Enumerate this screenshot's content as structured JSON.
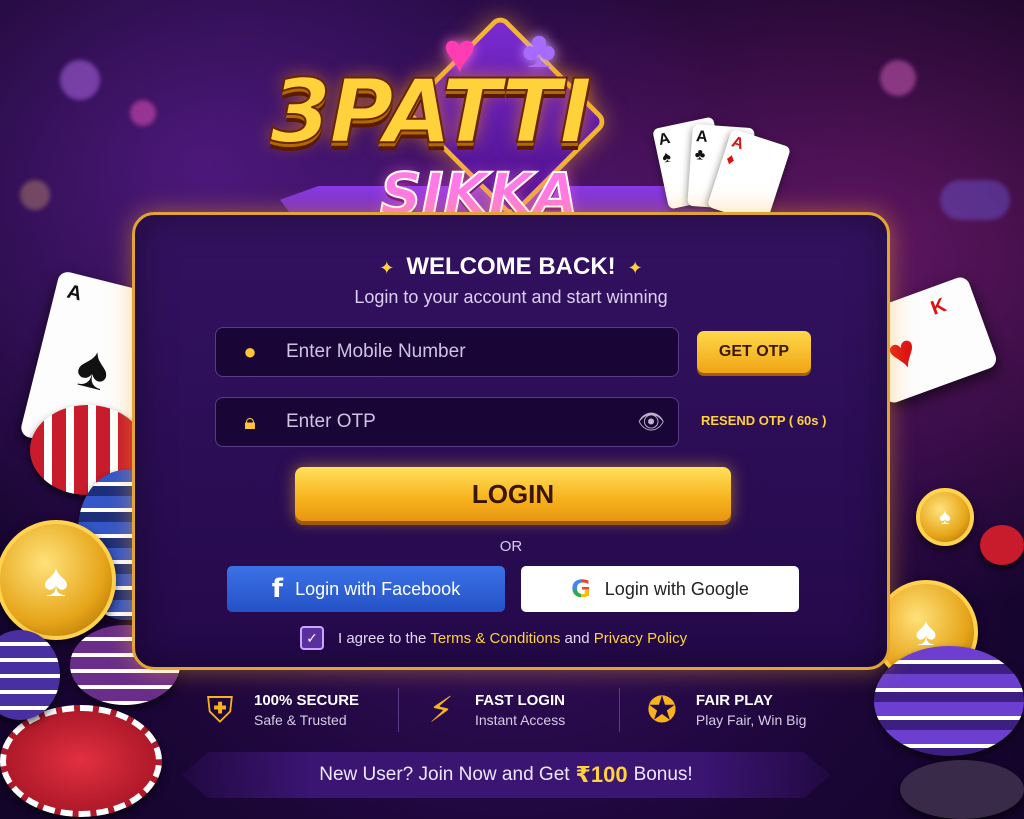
{
  "logo": {
    "line1": "3PATTI",
    "line2": "SIKKA",
    "card1_rank": "A",
    "card2_rank": "A",
    "card3_rank": "A"
  },
  "panel": {
    "welcome": "WELCOME BACK!",
    "subtitle": "Login to your account and start winning",
    "mobile_placeholder": "Enter Mobile Number",
    "otp_placeholder": "Enter OTP",
    "get_otp_label": "GET OTP",
    "resend_label": "RESEND OTP ( 60s )",
    "login_label": "LOGIN",
    "or_label": "OR",
    "facebook_label": "Login with Facebook",
    "google_label": "Login with Google",
    "agree_prefix": "I agree to the",
    "terms_label": "Terms & Conditions",
    "and_label": "and",
    "privacy_label": "Privacy Policy",
    "agree_checked": true
  },
  "features": [
    {
      "title": "100% SECURE",
      "subtitle": "Safe & Trusted",
      "icon": "shield-check-icon"
    },
    {
      "title": "FAST LOGIN",
      "subtitle": "Instant Access",
      "icon": "lightning-icon"
    },
    {
      "title": "FAIR PLAY",
      "subtitle": "Play Fair, Win Big",
      "icon": "medal-icon"
    }
  ],
  "bonus": {
    "prefix": "New User? Join Now and Get",
    "amount": "₹100",
    "suffix": "Bonus!"
  },
  "decor": {
    "left_card_rank": "A",
    "right_card_rank": "K"
  },
  "colors": {
    "accent_gold": "#ffd23c",
    "panel_bg": "#2a0d52",
    "facebook_blue": "#2f62d6",
    "link_yellow": "#ffd23c"
  }
}
